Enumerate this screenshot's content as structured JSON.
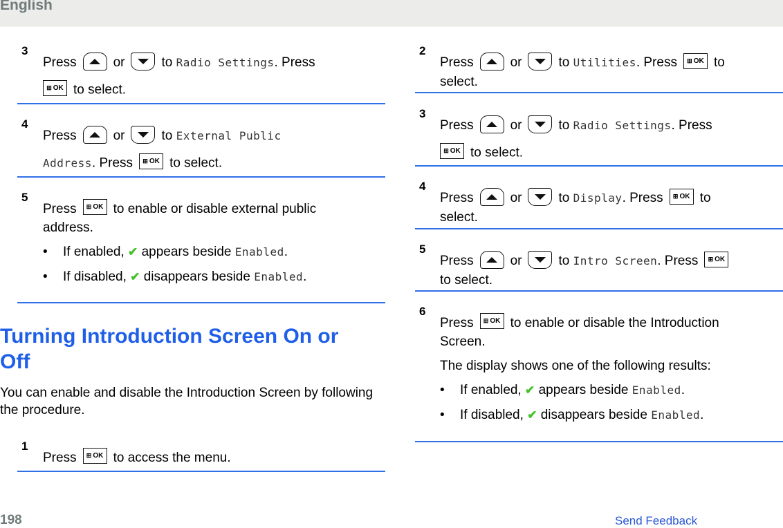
{
  "header": {
    "language": "English"
  },
  "footer": {
    "page_number": "198",
    "feedback_link": "Send Feedback"
  },
  "colors": {
    "accent_blue": "#2f6fe8",
    "heading_blue": "#1f5fe8",
    "check_green": "#43c12a"
  },
  "keys": {
    "up": "up-arrow-key",
    "down": "down-arrow-key",
    "ok": "menu-ok-key",
    "ok_label": "OK",
    "ok_grid": "⊞"
  },
  "left": {
    "steps": [
      {
        "num": "3",
        "press": "Press",
        "or": "or",
        "to": "to",
        "target": "Radio Settings",
        "press2": ". Press",
        "select": "to select."
      },
      {
        "num": "4",
        "press": "Press",
        "or": "or",
        "to": "to",
        "target_a": "External Public",
        "target_b": "Address",
        "press2": ". Press",
        "select": "to select."
      },
      {
        "num": "5",
        "press": "Press",
        "text": "to enable or disable external public",
        "text2": "address.",
        "bullets": [
          {
            "dot": "•",
            "pre": "If enabled,",
            "check": "✔",
            "post": "appears beside",
            "target": "Enabled",
            "end": "."
          },
          {
            "dot": "•",
            "pre": "If disabled,",
            "check": "✔",
            "post": "disappears beside",
            "target": "Enabled",
            "end": "."
          }
        ]
      }
    ],
    "section": {
      "title": "Turning Introduction Screen On or Off",
      "intro": "You can enable and disable the Introduction Screen by following the procedure.",
      "step1": {
        "num": "1",
        "press": "Press",
        "text": "to access the menu."
      }
    }
  },
  "right": {
    "steps": [
      {
        "num": "2",
        "press": "Press",
        "or": "or",
        "to": "to",
        "target": "Utilities",
        "press2": ". Press",
        "to2": "to",
        "select": "select."
      },
      {
        "num": "3",
        "press": "Press",
        "or": "or",
        "to": "to",
        "target": "Radio Settings",
        "press2": ". Press",
        "select": "to select."
      },
      {
        "num": "4",
        "press": "Press",
        "or": "or",
        "to": "to",
        "target": "Display",
        "press2": ". Press",
        "to2": "to",
        "select": "select."
      },
      {
        "num": "5",
        "press": "Press",
        "or": "or",
        "to": "to",
        "target": "Intro Screen",
        "press2": ". Press",
        "select": "to select."
      },
      {
        "num": "6",
        "press": "Press",
        "text": "to enable or disable the Introduction",
        "text2": "Screen.",
        "result": "The display shows one of the following results:",
        "bullets": [
          {
            "dot": "•",
            "pre": "If enabled,",
            "check": "✔",
            "post": "appears beside",
            "target": "Enabled",
            "end": "."
          },
          {
            "dot": "•",
            "pre": "If disabled,",
            "check": "✔",
            "post": "disappears beside",
            "target": "Enabled",
            "end": "."
          }
        ]
      }
    ]
  }
}
